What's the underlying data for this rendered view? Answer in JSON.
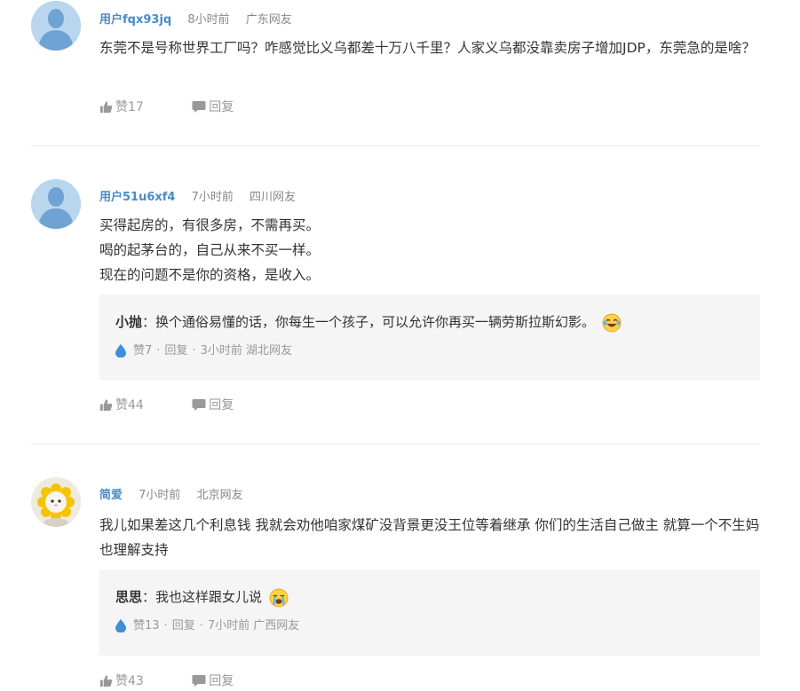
{
  "comments": [
    {
      "username": "用户fqx93jq",
      "time": "8小时前",
      "location": "广东网友",
      "text": [
        "东莞不是号称世界工厂吗？咋感觉比义乌都差十万八千里？人家义乌都没靠卖房子增加JDP，东莞急的是啥？"
      ],
      "like_label": "赞17",
      "reply_label": "回复"
    },
    {
      "username": "用户51u6xf4",
      "time": "7小时前",
      "location": "四川网友",
      "text": [
        "买得起房的，有很多房，不需再买。",
        "喝的起茅台的，自己从来不买一样。",
        "现在的问题不是你的资格，是收入。"
      ],
      "reply": {
        "name": "小抛",
        "text": "：换个通俗易懂的话，你每生一个孩子，可以允许你再买一辆劳斯拉斯幻影。",
        "likes": "赞7",
        "reply_label": "回复",
        "time": "3小时前",
        "location": "湖北网友"
      },
      "like_label": "赞44",
      "reply_label": "回复"
    },
    {
      "username": "简爱",
      "time": "7小时前",
      "location": "北京网友",
      "text": [
        "我儿如果差这几个利息钱 我就会劝他咱家煤矿没背景更没王位等着继承 你们的生活自己做主 就算一个不生妈也理解支持"
      ],
      "reply": {
        "name": "思思",
        "text": "：我也这样跟女儿说",
        "likes": "赞13",
        "reply_label": "回复",
        "time": "7小时前",
        "location": "广西网友"
      },
      "like_label": "赞43",
      "reply_label": "回复"
    }
  ],
  "separator": "·",
  "icons": {
    "avatar_default": "person-silhouette-icon",
    "avatar_custom": "cat-sunflower-avatar",
    "like": "thumbs-up-icon",
    "reply": "speech-bubble-icon",
    "reply_meta": "water-drop-icon",
    "emoji_laugh": "laughing-tears-emoji",
    "emoji_cry": "crying-emoji"
  },
  "colors": {
    "username": "#4a8bc9",
    "muted": "#999999",
    "reply_bg": "#f5f5f5",
    "drop": "#3d8fd8"
  }
}
